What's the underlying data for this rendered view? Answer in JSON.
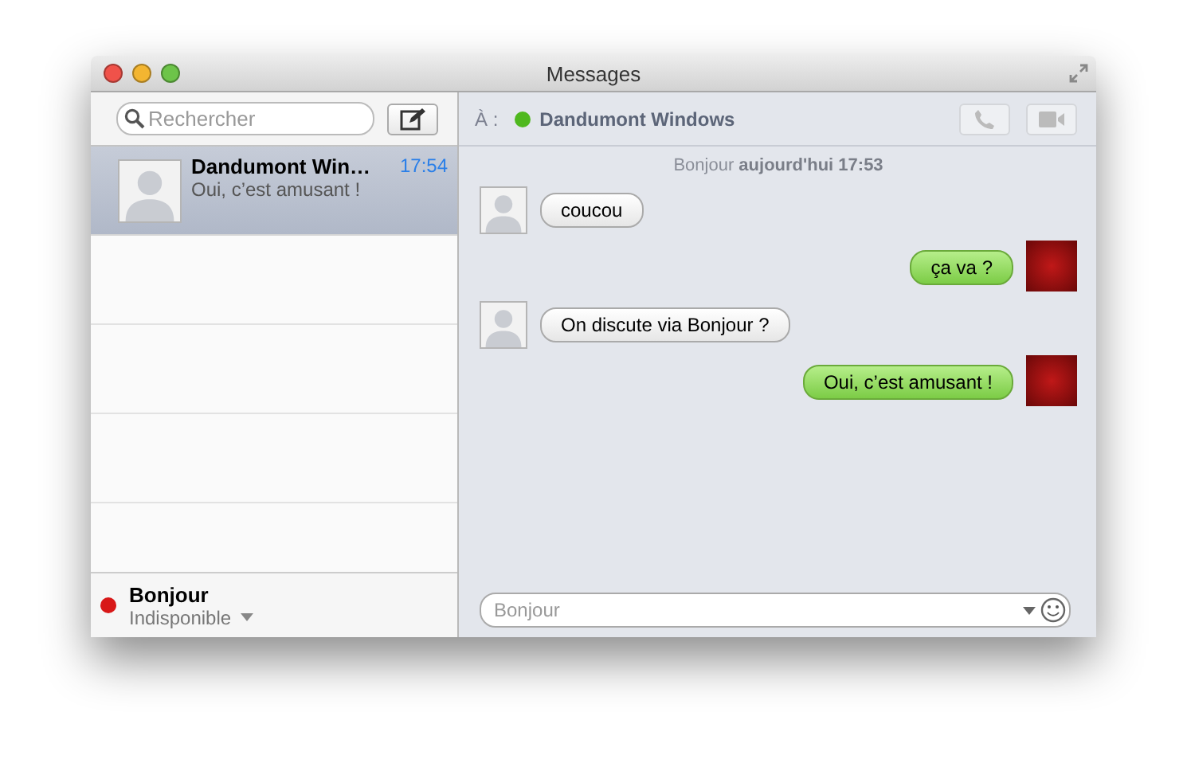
{
  "window": {
    "title": "Messages"
  },
  "sidebar": {
    "search": {
      "placeholder": "Rechercher"
    },
    "conversations": [
      {
        "name": "Dandumont Win…",
        "time": "17:54",
        "preview": "Oui, c’est amusant !",
        "selected": true
      }
    ],
    "account": {
      "name": "Bonjour",
      "status": "Indisponible",
      "color": "#d81818"
    }
  },
  "chat": {
    "to_label": "À :",
    "recipient": {
      "name": "Dandumont Windows",
      "color": "#4fb81e"
    },
    "date_line": "Bonjour **aujourd'hui 17:53**",
    "messages": [
      {
        "kind": "incoming",
        "text": "coucou"
      },
      {
        "kind": "outgoing",
        "text": "ça va ?"
      },
      {
        "kind": "incoming",
        "text": "On discute via Bonjour ?"
      },
      {
        "kind": "outgoing",
        "text": "Oui, c’est amusant !"
      }
    ],
    "input": {
      "placeholder": "Bonjour"
    }
  }
}
